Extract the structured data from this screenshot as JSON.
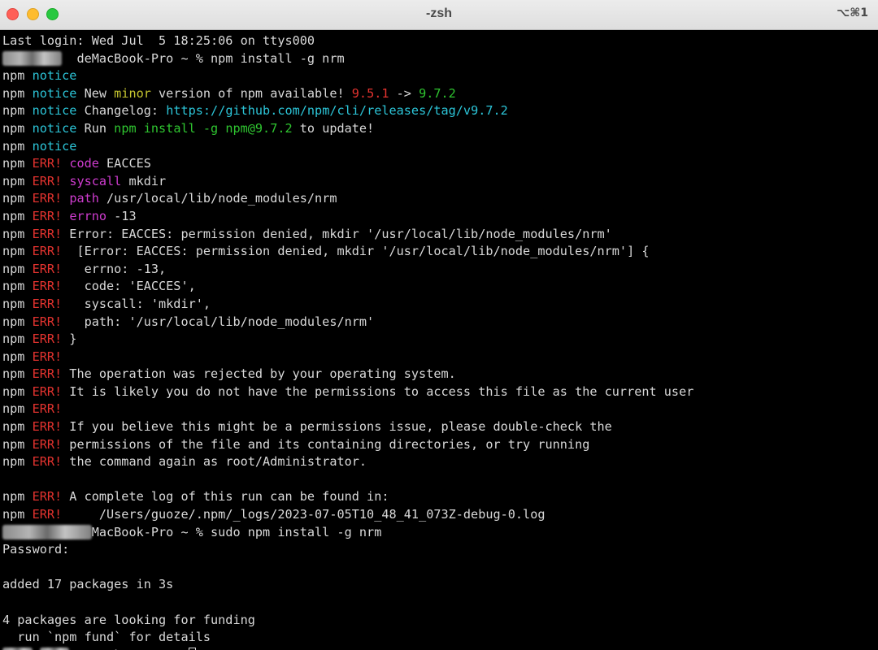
{
  "window": {
    "title": "-zsh",
    "shortcut": "⌥⌘1"
  },
  "colors": {
    "background": "#000000",
    "text": "#d9d9d9",
    "notice": "#2cc5d8",
    "error": "#e4332f",
    "key": "#cf3ccf",
    "minor": "#c6c630",
    "new_version": "#2fc530"
  },
  "terminal": {
    "lines": [
      [
        {
          "t": "Last login: Wed Jul  5 18:25:06 on ttys000",
          "c": "white"
        }
      ],
      [
        {
          "t": "        ",
          "c": "blur"
        },
        {
          "t": "  deMacBook-Pro ~ % npm install -g nrm",
          "c": "white"
        }
      ],
      [
        {
          "t": "npm ",
          "c": "white"
        },
        {
          "t": "notice",
          "c": "cyan"
        }
      ],
      [
        {
          "t": "npm ",
          "c": "white"
        },
        {
          "t": "notice",
          "c": "cyan"
        },
        {
          "t": " New ",
          "c": "white"
        },
        {
          "t": "minor",
          "c": "yellow"
        },
        {
          "t": " version of npm available! ",
          "c": "white"
        },
        {
          "t": "9.5.1",
          "c": "red"
        },
        {
          "t": " -> ",
          "c": "white"
        },
        {
          "t": "9.7.2",
          "c": "green"
        }
      ],
      [
        {
          "t": "npm ",
          "c": "white"
        },
        {
          "t": "notice",
          "c": "cyan"
        },
        {
          "t": " Changelog: ",
          "c": "white"
        },
        {
          "t": "https://github.com/npm/cli/releases/tag/v9.7.2",
          "c": "cyan"
        }
      ],
      [
        {
          "t": "npm ",
          "c": "white"
        },
        {
          "t": "notice",
          "c": "cyan"
        },
        {
          "t": " Run ",
          "c": "white"
        },
        {
          "t": "npm install -g npm@9.7.2",
          "c": "green"
        },
        {
          "t": " to update!",
          "c": "white"
        }
      ],
      [
        {
          "t": "npm ",
          "c": "white"
        },
        {
          "t": "notice",
          "c": "cyan"
        }
      ],
      [
        {
          "t": "npm ",
          "c": "white"
        },
        {
          "t": "ERR!",
          "c": "red"
        },
        {
          "t": " ",
          "c": "white"
        },
        {
          "t": "code",
          "c": "magenta"
        },
        {
          "t": " EACCES",
          "c": "white"
        }
      ],
      [
        {
          "t": "npm ",
          "c": "white"
        },
        {
          "t": "ERR!",
          "c": "red"
        },
        {
          "t": " ",
          "c": "white"
        },
        {
          "t": "syscall",
          "c": "magenta"
        },
        {
          "t": " mkdir",
          "c": "white"
        }
      ],
      [
        {
          "t": "npm ",
          "c": "white"
        },
        {
          "t": "ERR!",
          "c": "red"
        },
        {
          "t": " ",
          "c": "white"
        },
        {
          "t": "path",
          "c": "magenta"
        },
        {
          "t": " /usr/local/lib/node_modules/nrm",
          "c": "white"
        }
      ],
      [
        {
          "t": "npm ",
          "c": "white"
        },
        {
          "t": "ERR!",
          "c": "red"
        },
        {
          "t": " ",
          "c": "white"
        },
        {
          "t": "errno",
          "c": "magenta"
        },
        {
          "t": " -13",
          "c": "white"
        }
      ],
      [
        {
          "t": "npm ",
          "c": "white"
        },
        {
          "t": "ERR!",
          "c": "red"
        },
        {
          "t": " Error: EACCES: permission denied, mkdir '/usr/local/lib/node_modules/nrm'",
          "c": "white"
        }
      ],
      [
        {
          "t": "npm ",
          "c": "white"
        },
        {
          "t": "ERR!",
          "c": "red"
        },
        {
          "t": "  [Error: EACCES: permission denied, mkdir '/usr/local/lib/node_modules/nrm'] {",
          "c": "white"
        }
      ],
      [
        {
          "t": "npm ",
          "c": "white"
        },
        {
          "t": "ERR!",
          "c": "red"
        },
        {
          "t": "   errno: -13,",
          "c": "white"
        }
      ],
      [
        {
          "t": "npm ",
          "c": "white"
        },
        {
          "t": "ERR!",
          "c": "red"
        },
        {
          "t": "   code: 'EACCES',",
          "c": "white"
        }
      ],
      [
        {
          "t": "npm ",
          "c": "white"
        },
        {
          "t": "ERR!",
          "c": "red"
        },
        {
          "t": "   syscall: 'mkdir',",
          "c": "white"
        }
      ],
      [
        {
          "t": "npm ",
          "c": "white"
        },
        {
          "t": "ERR!",
          "c": "red"
        },
        {
          "t": "   path: '/usr/local/lib/node_modules/nrm'",
          "c": "white"
        }
      ],
      [
        {
          "t": "npm ",
          "c": "white"
        },
        {
          "t": "ERR!",
          "c": "red"
        },
        {
          "t": " }",
          "c": "white"
        }
      ],
      [
        {
          "t": "npm ",
          "c": "white"
        },
        {
          "t": "ERR!",
          "c": "red"
        }
      ],
      [
        {
          "t": "npm ",
          "c": "white"
        },
        {
          "t": "ERR!",
          "c": "red"
        },
        {
          "t": " The operation was rejected by your operating system.",
          "c": "white"
        }
      ],
      [
        {
          "t": "npm ",
          "c": "white"
        },
        {
          "t": "ERR!",
          "c": "red"
        },
        {
          "t": " It is likely you do not have the permissions to access this file as the current user",
          "c": "white"
        }
      ],
      [
        {
          "t": "npm ",
          "c": "white"
        },
        {
          "t": "ERR!",
          "c": "red"
        }
      ],
      [
        {
          "t": "npm ",
          "c": "white"
        },
        {
          "t": "ERR!",
          "c": "red"
        },
        {
          "t": " If you believe this might be a permissions issue, please double-check the",
          "c": "white"
        }
      ],
      [
        {
          "t": "npm ",
          "c": "white"
        },
        {
          "t": "ERR!",
          "c": "red"
        },
        {
          "t": " permissions of the file and its containing directories, or try running",
          "c": "white"
        }
      ],
      [
        {
          "t": "npm ",
          "c": "white"
        },
        {
          "t": "ERR!",
          "c": "red"
        },
        {
          "t": " the command again as root/Administrator.",
          "c": "white"
        }
      ],
      [],
      [
        {
          "t": "npm ",
          "c": "white"
        },
        {
          "t": "ERR!",
          "c": "red"
        },
        {
          "t": " A complete log of this run can be found in:",
          "c": "white"
        }
      ],
      [
        {
          "t": "npm ",
          "c": "white"
        },
        {
          "t": "ERR!",
          "c": "red"
        },
        {
          "t": "     /Users/guoze/.npm/_logs/2023-07-05T10_48_41_073Z-debug-0.log",
          "c": "white"
        }
      ],
      [
        {
          "t": "            ",
          "c": "blur"
        },
        {
          "t": "MacBook-Pro ~ % sudo npm install -g nrm",
          "c": "white"
        }
      ],
      [
        {
          "t": "Password:",
          "c": "white"
        }
      ],
      [],
      [
        {
          "t": "added 17 packages in 3s",
          "c": "white"
        }
      ],
      [],
      [
        {
          "t": "4 packages are looking for funding",
          "c": "white"
        }
      ],
      [
        {
          "t": "  run `npm fund` for details",
          "c": "white"
        }
      ],
      [
        {
          "t": "    ",
          "c": "blur"
        },
        {
          "t": " ",
          "c": "white"
        },
        {
          "t": "    ",
          "c": "blur"
        },
        {
          "t": "MacBook-Pro ~ % ",
          "c": "white"
        },
        {
          "t": "",
          "c": "cursor"
        }
      ]
    ]
  }
}
